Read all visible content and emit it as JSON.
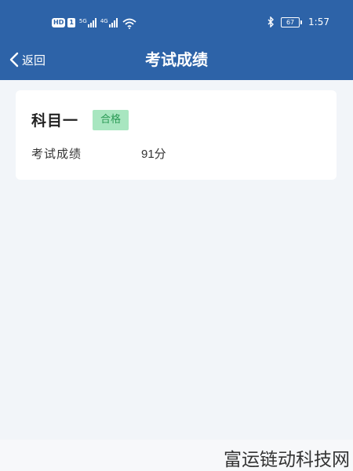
{
  "status_bar": {
    "hd": "HD",
    "sim": "1",
    "network_1": "5G",
    "network_2": "4G",
    "battery_level": "67",
    "time": "1:57"
  },
  "nav": {
    "back_label": "返回",
    "title": "考试成绩"
  },
  "result": {
    "subject": "科目一",
    "status": "合格",
    "score_label": "考试成绩",
    "score_value": "91分"
  },
  "watermark": "富运链动科技网",
  "colors": {
    "header": "#2d63a8",
    "background": "#f2f5f9",
    "badge_bg": "#a8e6c0",
    "badge_text": "#2a9a55"
  },
  "icons": {
    "back": "chevron-left-icon",
    "wifi": "wifi-icon",
    "bluetooth": "bluetooth-icon",
    "battery": "battery-icon",
    "signal": "signal-icon"
  }
}
